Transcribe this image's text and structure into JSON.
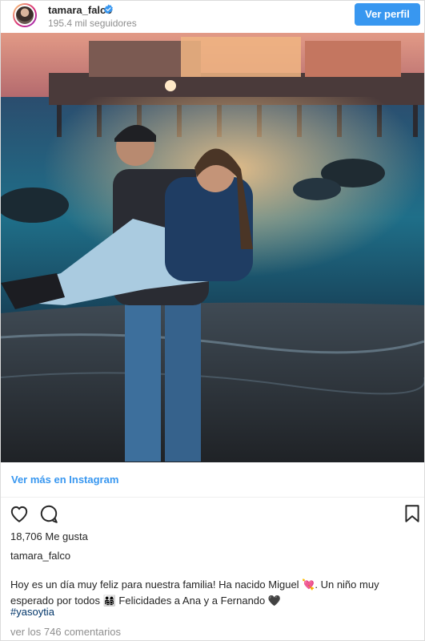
{
  "header": {
    "username": "tamara_falco",
    "followers": "195.4 mil seguidores",
    "follow_button": "Ver perfil",
    "verified_icon": "verified-badge-icon",
    "verified_color": "#3897f0"
  },
  "photo": {
    "description_icon": "post-photo"
  },
  "link": {
    "label": "Ver más en Instagram",
    "color": "#3897f0"
  },
  "actions": {
    "like_icon": "heart-outline-icon",
    "comment_icon": "comment-bubble-icon",
    "save_icon": "bookmark-icon"
  },
  "post": {
    "likes": "18,706 Me gusta",
    "owner": "tamara_falco",
    "caption_line1": "Hoy es un día muy feliz para nuestra familia! Ha nacido Miguel 💘. Un niño muy",
    "caption_line2": "esperado por todos 👨‍👩‍👧‍👦 Felicidades a Ana y a Fernando 🖤",
    "hashtag": "#yasoytia",
    "comments": "ver los 746 comentarios"
  }
}
